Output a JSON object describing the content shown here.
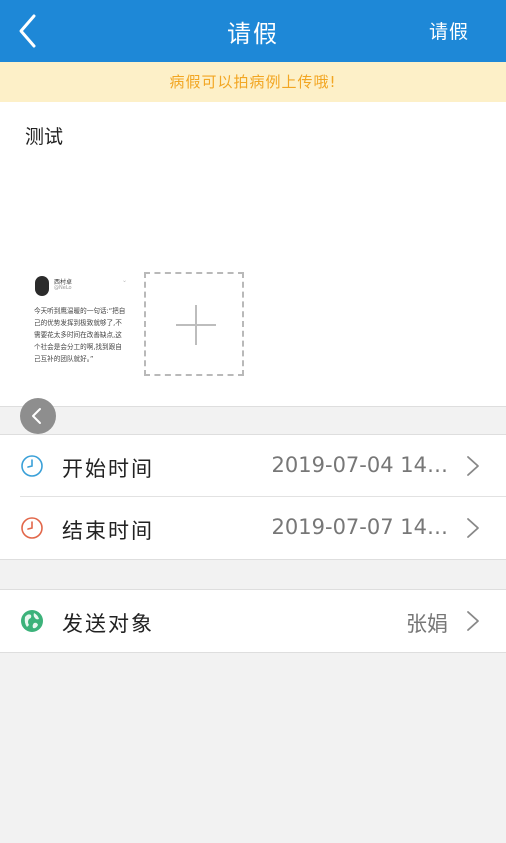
{
  "header": {
    "title": "请假",
    "action_label": "请假"
  },
  "notice": {
    "text": "病假可以拍病例上传哦!"
  },
  "form": {
    "content_text": "测试"
  },
  "attachment": {
    "name": "西村卓",
    "handle": "@NeLo",
    "post": "今天听到鹰温暖的一句话:“把自己的优势发挥到极致就够了,不需要花太多时间在改善缺点,这个社会是会分工的啊,找到跟自己互补的团队就好。”"
  },
  "rows": [
    {
      "label": "开始时间",
      "value": "2019-07-04 14…"
    },
    {
      "label": "结束时间",
      "value": "2019-07-07 14…"
    }
  ],
  "recipient": {
    "label": "发送对象",
    "value": "张娟"
  },
  "colors": {
    "header_bg": "#1e88d7",
    "notice_bg": "#fdf0c8",
    "notice_text": "#f2a623",
    "start_icon": "#3aa0d8",
    "end_icon": "#e2674a",
    "recipient_icon": "#3cb27a"
  },
  "icons": {
    "back": "chevron-left-icon",
    "start": "clock-icon",
    "end": "clock-icon",
    "recipient": "globe-icon",
    "add": "plus-icon"
  }
}
